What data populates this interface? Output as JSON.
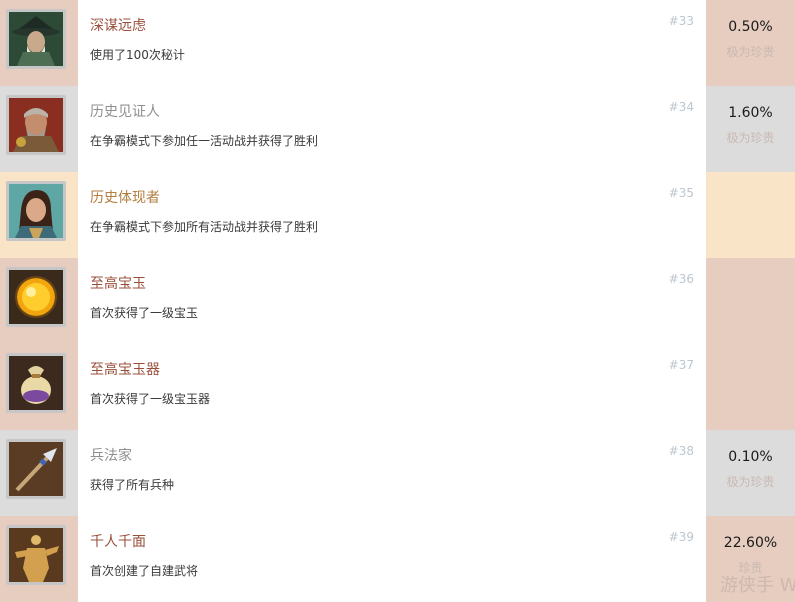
{
  "achievements": [
    {
      "title": "深谋远虑",
      "desc": "使用了100次秘计",
      "num": "#33",
      "percent": "0.50%",
      "rarity": "极为珍贵",
      "tier": "rare",
      "icon": "hooded-general-portrait-icon"
    },
    {
      "title": "历史见证人",
      "desc": "在争霸模式下参加任一活动战并获得了胜利",
      "num": "#34",
      "percent": "1.60%",
      "rarity": "极为珍贵",
      "tier": "common",
      "icon": "bearded-warrior-portrait-icon"
    },
    {
      "title": "历史体现者",
      "desc": "在争霸模式下参加所有活动战并获得了胜利",
      "num": "#35",
      "percent": "",
      "rarity": "",
      "tier": "gold",
      "icon": "young-hero-portrait-icon"
    },
    {
      "title": "至高宝玉",
      "desc": "首次获得了一级宝玉",
      "num": "#36",
      "percent": "",
      "rarity": "",
      "tier": "rare",
      "icon": "golden-orb-icon"
    },
    {
      "title": "至高宝玉器",
      "desc": "首次获得了一级宝玉器",
      "num": "#37",
      "percent": "",
      "rarity": "",
      "tier": "rare",
      "icon": "treasure-pouch-icon"
    },
    {
      "title": "兵法家",
      "desc": "获得了所有兵种",
      "num": "#38",
      "percent": "0.10%",
      "rarity": "极为珍贵",
      "tier": "common",
      "icon": "spear-icon"
    },
    {
      "title": "千人千面",
      "desc": "首次创建了自建武将",
      "num": "#39",
      "percent": "22.60%",
      "rarity": "珍贵",
      "tier": "rare",
      "icon": "warrior-silhouette-icon"
    }
  ],
  "tiers": {
    "rare": {
      "side_bg": "#e6cdbf",
      "title_color": "#9a4f3c"
    },
    "common": {
      "side_bg": "#dcdcdc",
      "title_color": "#8f8f8f"
    },
    "gold": {
      "side_bg": "#f9e4c7",
      "title_color": "#b27d3d"
    }
  },
  "watermark": "游侠手 W"
}
